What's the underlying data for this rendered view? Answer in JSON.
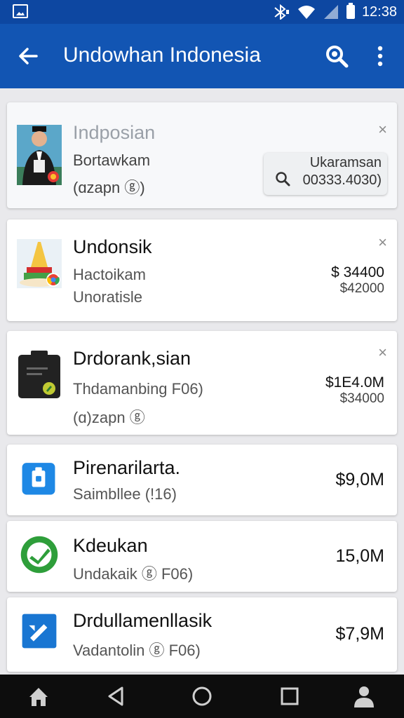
{
  "status_bar": {
    "time": "12:38",
    "icons": [
      "image-icon",
      "bluetooth-icon",
      "wifi-icon",
      "signal-icon",
      "battery-icon"
    ]
  },
  "app_bar": {
    "title": "Undowhan Indonesia",
    "icons": [
      "back-arrow-icon",
      "search-icon",
      "more-vert-icon"
    ]
  },
  "colors": {
    "app_bar": "#1255b3",
    "status_bar": "#0d47a1",
    "background": "#e9e9ec"
  },
  "items": [
    {
      "name": "Indposian",
      "sub1": "Bortawkam",
      "sub2": "(ɑzapn ⓖ)",
      "close": "×",
      "pill": {
        "label": "Ukaramsan",
        "value": "00333.4030)"
      }
    },
    {
      "name": "Undonsik",
      "sub1": "Hactoikam",
      "sub2": "Unoratisle",
      "close": "×",
      "price1": "$ 34400",
      "price2": "$42000"
    },
    {
      "name": "Drdorank,sian",
      "sub1": "Thdamanbing F06)",
      "sub2": "(ɑ)zapn ⓖ",
      "close": "×",
      "price1": "$1E4.0M",
      "price2": "$34000"
    },
    {
      "name": "Pirenarilarta.",
      "sub1": "Saimbllee (!16)",
      "price": "$9,0M"
    },
    {
      "name": "Kdeukan",
      "sub1": "Undakaik ⓖ F06)",
      "price": "15,0M"
    },
    {
      "name": "Drdullamenllasik",
      "sub1": "Vadantolin ⓖ F06)",
      "price": "$7,9M"
    }
  ],
  "nav_bar": {
    "icons": [
      "home-icon",
      "back-triangle-icon",
      "home-circle-icon",
      "recents-square-icon",
      "person-icon"
    ]
  }
}
